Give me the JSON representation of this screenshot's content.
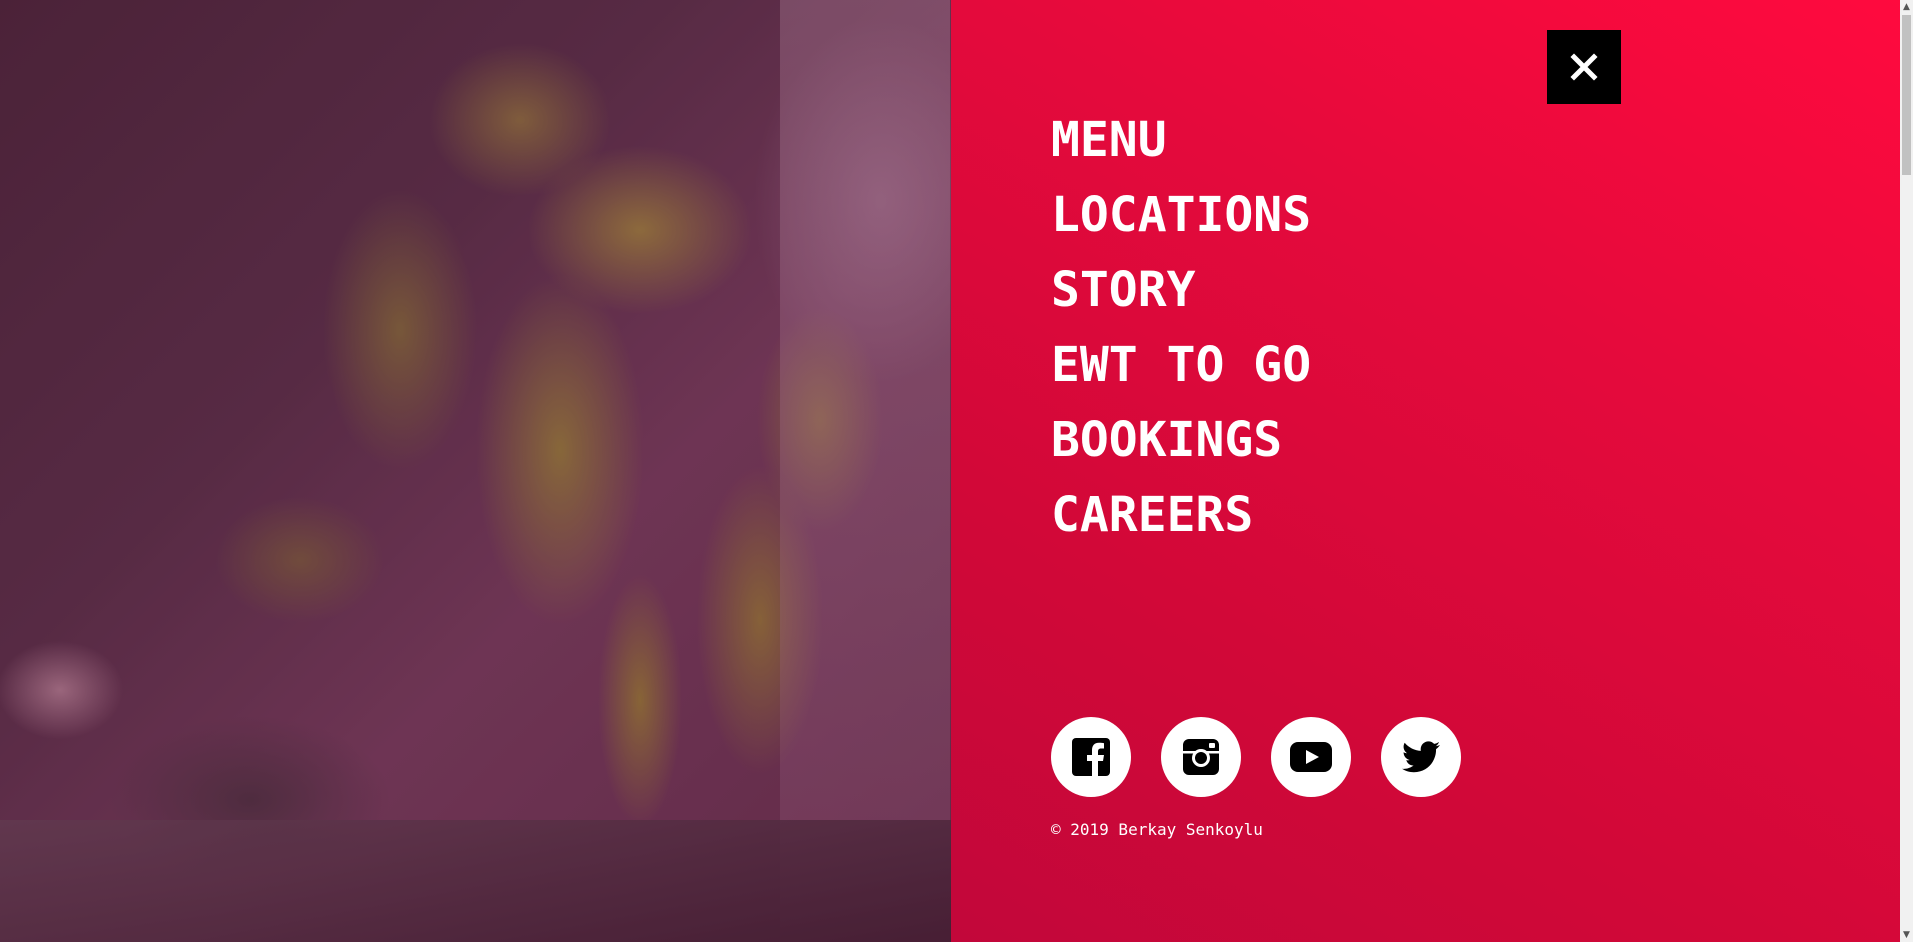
{
  "nav": {
    "close_icon": "close-icon",
    "items": [
      {
        "label": "MENU"
      },
      {
        "label": "LOCATIONS"
      },
      {
        "label": "STORY"
      },
      {
        "label": "EWT TO GO"
      },
      {
        "label": "BOOKINGS"
      },
      {
        "label": "CAREERS"
      }
    ]
  },
  "social": [
    {
      "icon": "facebook-icon"
    },
    {
      "icon": "instagram-icon"
    },
    {
      "icon": "youtube-icon"
    },
    {
      "icon": "twitter-icon"
    }
  ],
  "footer": {
    "copyright": "© 2019 Berkay Senkoylu"
  },
  "colors": {
    "panel_accent": "#e50a3c",
    "text": "#ffffff",
    "close_bg": "#000000"
  }
}
